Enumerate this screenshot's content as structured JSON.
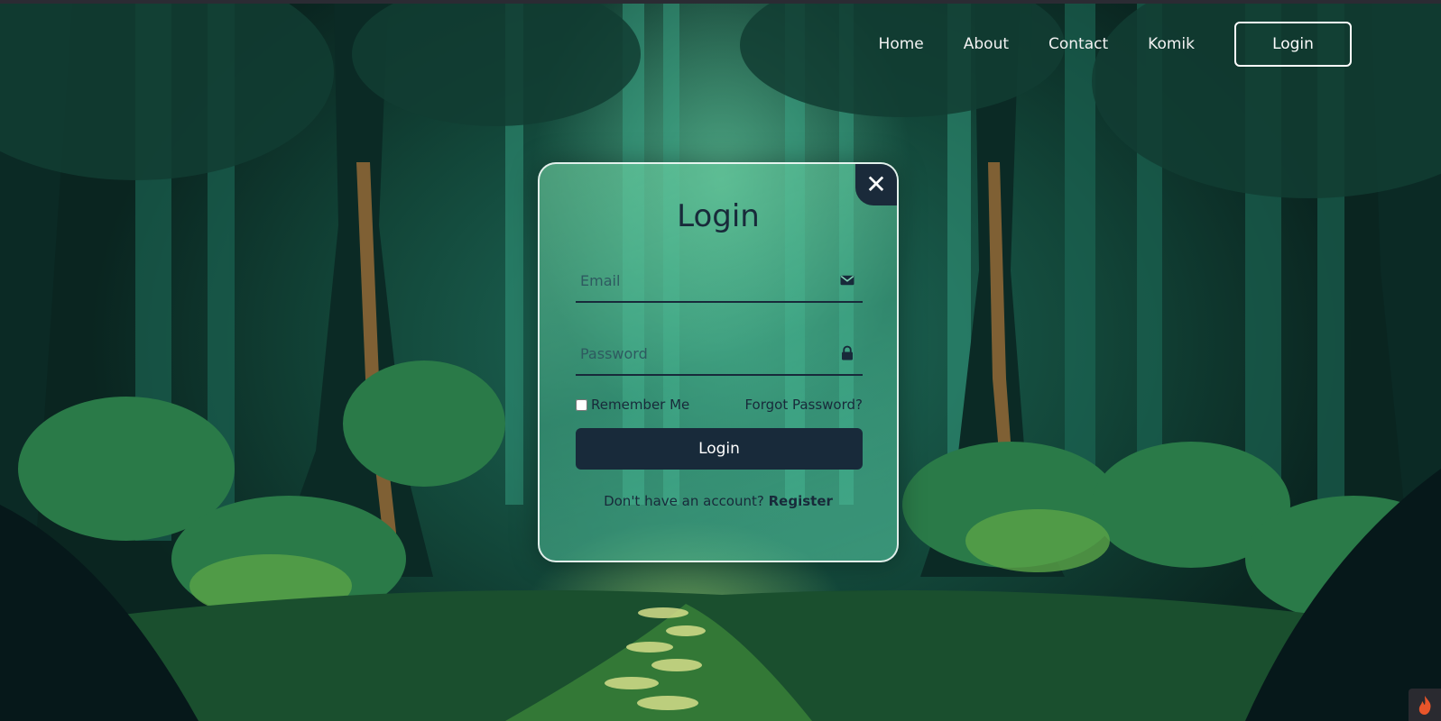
{
  "nav": {
    "links": [
      "Home",
      "About",
      "Contact",
      "Komik"
    ],
    "login_label": "Login"
  },
  "modal": {
    "title": "Login",
    "close_label": "✕",
    "email_placeholder": "Email",
    "password_placeholder": "Password",
    "remember_label": "Remember Me",
    "forgot_label": "Forgot Password?",
    "submit_label": "Login",
    "register_prompt": "Don't have an account?",
    "register_label": "Register"
  },
  "icons": {
    "email": "envelope-icon",
    "password": "lock-icon",
    "close": "close-icon",
    "corner": "flame-icon"
  },
  "colors": {
    "primary_dark": "#182a3a",
    "accent_green": "#4fbf95",
    "nav_text": "#f2f2f2"
  }
}
